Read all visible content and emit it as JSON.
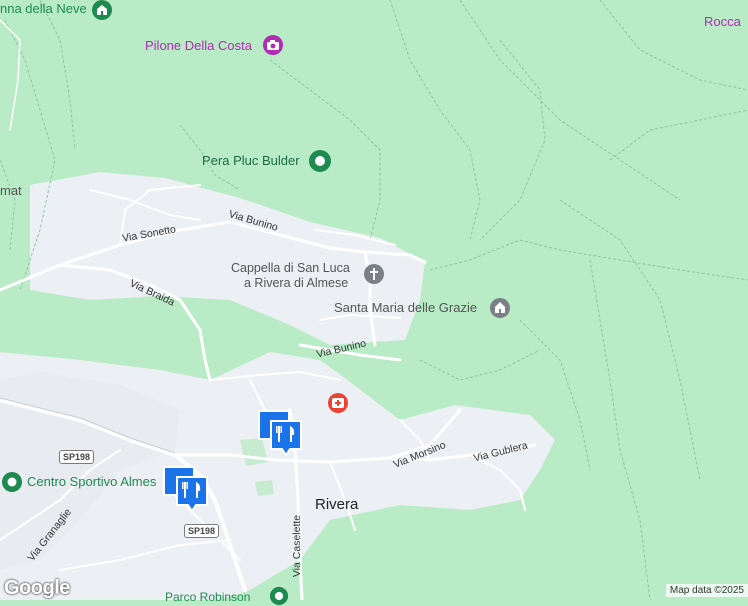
{
  "map": {
    "places": {
      "neve": "nna della Neve",
      "pilone": "Pilone Della Costa",
      "rocca": "Rocca",
      "pera": "Pera Pluc Bulder",
      "amat": "mat",
      "cappella_line1": "Cappella di San Luca",
      "cappella_line2": "a Rivera di Almese",
      "santa_maria": "Santa Maria delle Grazie",
      "centro_sportivo": "Centro Sportivo Almes",
      "rivera": "Rivera",
      "parco": "Parco Robinson"
    },
    "streets": {
      "bunino_top": "Via Bunino",
      "sonetto": "Via Sonetto",
      "braida": "Via Braida",
      "bunino_bottom": "Via Bunino",
      "morsino": "Via Morsino",
      "gublera": "Via Gublera",
      "granaglie": "Via Granaglie",
      "caselette": "Via Caselette"
    },
    "shields": {
      "sp198_a": "SP198",
      "sp198_b": "SP198"
    },
    "logo": "Google",
    "attribution": "Map data ©2025"
  },
  "colors": {
    "forest": "#b9ecc6",
    "urban": "#eceff3",
    "road": "#ffffff",
    "trail": "#8ac6a4",
    "poi_green": "#1e8a50",
    "poi_magenta": "#b12bb4",
    "marker_blue": "#1a73e8",
    "hospital_red": "#ea4335"
  },
  "icons": [
    "church-icon",
    "camera-icon",
    "park-icon",
    "cross-icon",
    "restaurant-marker-icon",
    "hospital-icon"
  ]
}
